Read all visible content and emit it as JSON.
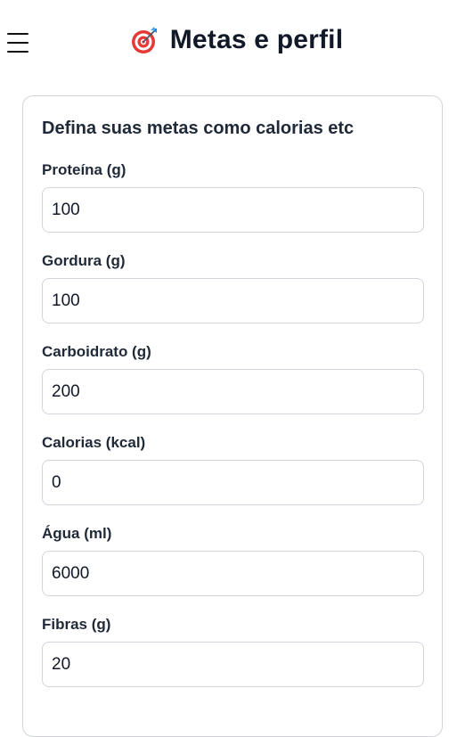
{
  "header": {
    "title": "Metas e perfil",
    "menu_icon": "hamburger-menu-icon",
    "title_icon": "target-dart-icon"
  },
  "card": {
    "heading": "Defina suas metas como calorias etc"
  },
  "fields": [
    {
      "label": "Proteína (g)",
      "value": "100"
    },
    {
      "label": "Gordura (g)",
      "value": "100"
    },
    {
      "label": "Carboidrato (g)",
      "value": "200"
    },
    {
      "label": "Calorias (kcal)",
      "value": "0"
    },
    {
      "label": "Água (ml)",
      "value": "6000"
    },
    {
      "label": "Fibras (g)",
      "value": "20"
    }
  ],
  "colors": {
    "border": "#d1d5db",
    "text": "#111827",
    "target_red": "#e53935",
    "dart_blue": "#1e88e5"
  }
}
